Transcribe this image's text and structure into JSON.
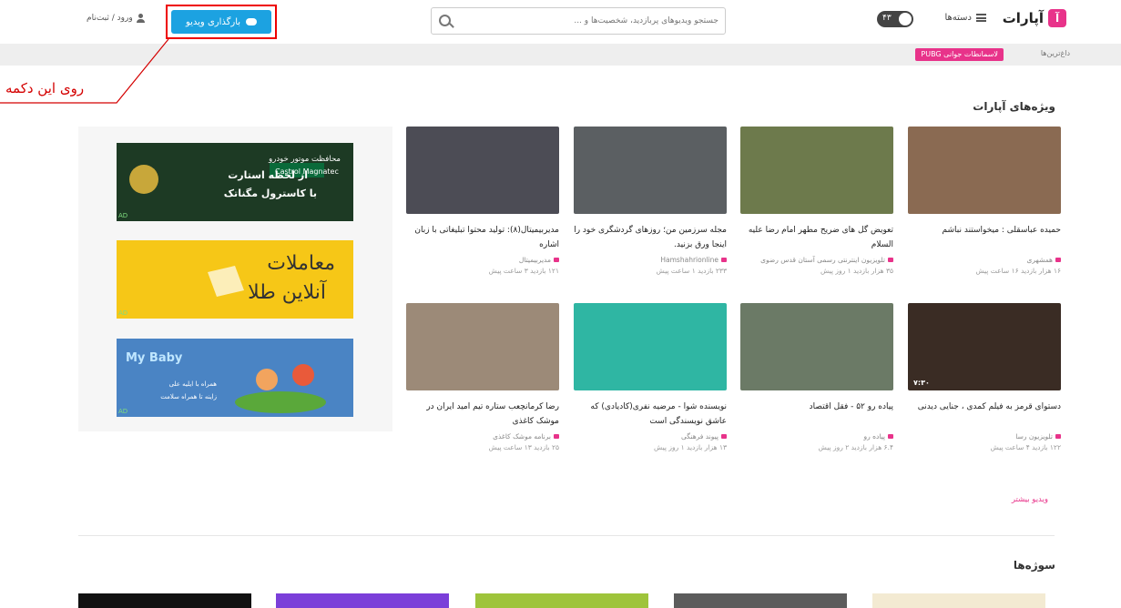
{
  "header": {
    "logo_text": "آپارات",
    "logo_glyph": "آ",
    "categories_label": "دسته‌ها",
    "theme_value": "۴۳",
    "search_placeholder": "جستجو ویدیوهای پربازدید، شخصیت‌ها و ...",
    "upload_label": "بارگذاری ویدیو",
    "login_label": "ورود / ثبت‌نام"
  },
  "subbar": {
    "promo_label": "لاسمانطات جوانی PUBG",
    "label": "داغ‌ترین‌ها"
  },
  "annotation": {
    "text": "روی این دکمه",
    "color": "#d40000"
  },
  "section_featured": {
    "title": "ویژه‌های آپارات",
    "more_label": "ویدیو بیشتر"
  },
  "videos": [
    {
      "title": "حمیده عباسقلی : میخواستند نباشم",
      "channel": "همشهری",
      "meta": "۱۶ هزار بازدید  ۱۶ ساعت پیش",
      "duration": "",
      "color": "#8a6a52"
    },
    {
      "title": "تعویض گل های ضریح مطهر امام رضا علیه السلام",
      "channel": "تلویزیون اینترنتی رسمی آستان قدس رضوی",
      "meta": "۳۵ هزار بازدید  ۱ روز پیش",
      "duration": "",
      "color": "#6d7a4c"
    },
    {
      "title": "مجله سرزمین من؛ روزهای گردشگری خود را اینجا ورق بزنید.",
      "channel": "Hamshahrionline",
      "meta": "۲۳۳ بازدید  ۱ ساعت پیش",
      "duration": "",
      "color": "#5b5f62"
    },
    {
      "title": "مدیربیمیتال(۸): تولید محتوا تبلیغاتی با زبان اشاره",
      "channel": "مدیربیمیتال",
      "meta": "۱۲۱ بازدید  ۳ ساعت پیش",
      "duration": "",
      "color": "#4c4c55"
    },
    {
      "title": "دستوای قرمز به فیلم کمدی ، جنایی دیدنی",
      "channel": "تلویزیون رسا",
      "meta": "۱۲۲ بازدید  ۴ ساعت پیش",
      "duration": "۷:۳۰",
      "color": "#3a2c24"
    },
    {
      "title": "پیاده رو ۵۲ - فقل اقتصاد",
      "channel": "پیاده رو",
      "meta": "۶.۴ هزار بازدید  ۲ روز پیش",
      "duration": "",
      "color": "#6b7a66"
    },
    {
      "title": "نویسنده شوا - مرضیه نفری(کادیادی) که عاشق نویسندگی است",
      "channel": "پیوند فرهنگی",
      "meta": "۱۳ هزار بازدید  ۱ روز پیش",
      "duration": "",
      "color": "#2fb6a3"
    },
    {
      "title": "رضا کرمانچعب ستاره تیم امید ایران در موشک کاغذی",
      "channel": "برنامه موشک کاغذی",
      "meta": "۲۵ بازدید  ۱۳ ساعت پیش",
      "duration": "",
      "color": "#9c8a78"
    }
  ],
  "ads": [
    {
      "line1": "محافظت موتور خودرو",
      "line2": "از لحظه استارت",
      "line3": "با کاسترول مگناتک",
      "brand": "Castrol Magnatec",
      "color": "#1d3a24"
    },
    {
      "line1": "معاملات",
      "line2": "آنلاین طلا",
      "color": "#f6c717"
    },
    {
      "line1": "My Baby",
      "line2": "همراه با ایلیه علی",
      "line3": "زاینه تا همراه سلامت",
      "color": "#4a84c4"
    }
  ],
  "ad_mark": "AD",
  "section_topics": {
    "title": "سوژه‌ها"
  },
  "bottom_thumbs": [
    "#f3ead2",
    "#5c5c5c",
    "#9ec43b",
    "#7b3fd9",
    "#111111"
  ]
}
